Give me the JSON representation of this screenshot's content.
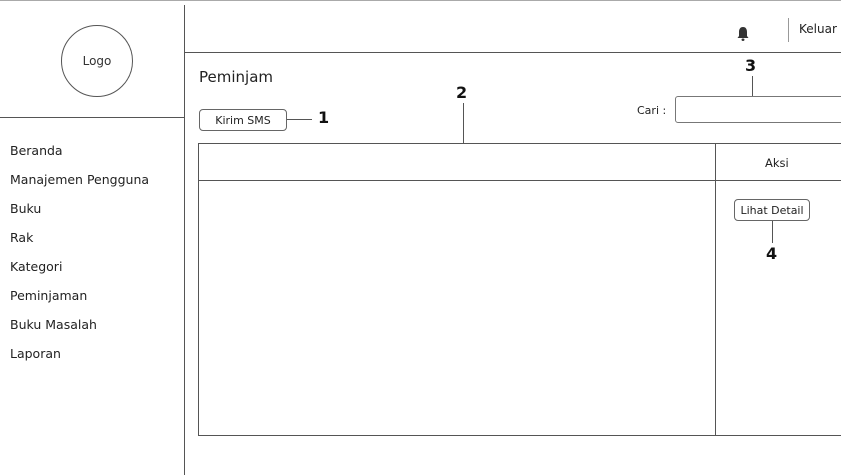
{
  "sidebar": {
    "logo": "Logo",
    "items": [
      {
        "label": "Beranda"
      },
      {
        "label": "Manajemen Pengguna"
      },
      {
        "label": "Buku"
      },
      {
        "label": "Rak"
      },
      {
        "label": "Kategori"
      },
      {
        "label": "Peminjaman"
      },
      {
        "label": "Buku Masalah"
      },
      {
        "label": "Laporan"
      }
    ]
  },
  "header": {
    "icon": "bell-icon",
    "logout_label": "Keluar"
  },
  "main": {
    "title": "Peminjam",
    "sms_button": "Kirim SMS",
    "search": {
      "label": "Cari :",
      "value": "",
      "placeholder": ""
    },
    "table": {
      "columns": [
        "",
        "Aksi"
      ],
      "row_action": "Lihat Detail"
    }
  },
  "annotations": {
    "a1": "1",
    "a2": "2",
    "a3": "3",
    "a4": "4"
  },
  "colors": {
    "line": "#555555",
    "background": "#ffffff"
  }
}
